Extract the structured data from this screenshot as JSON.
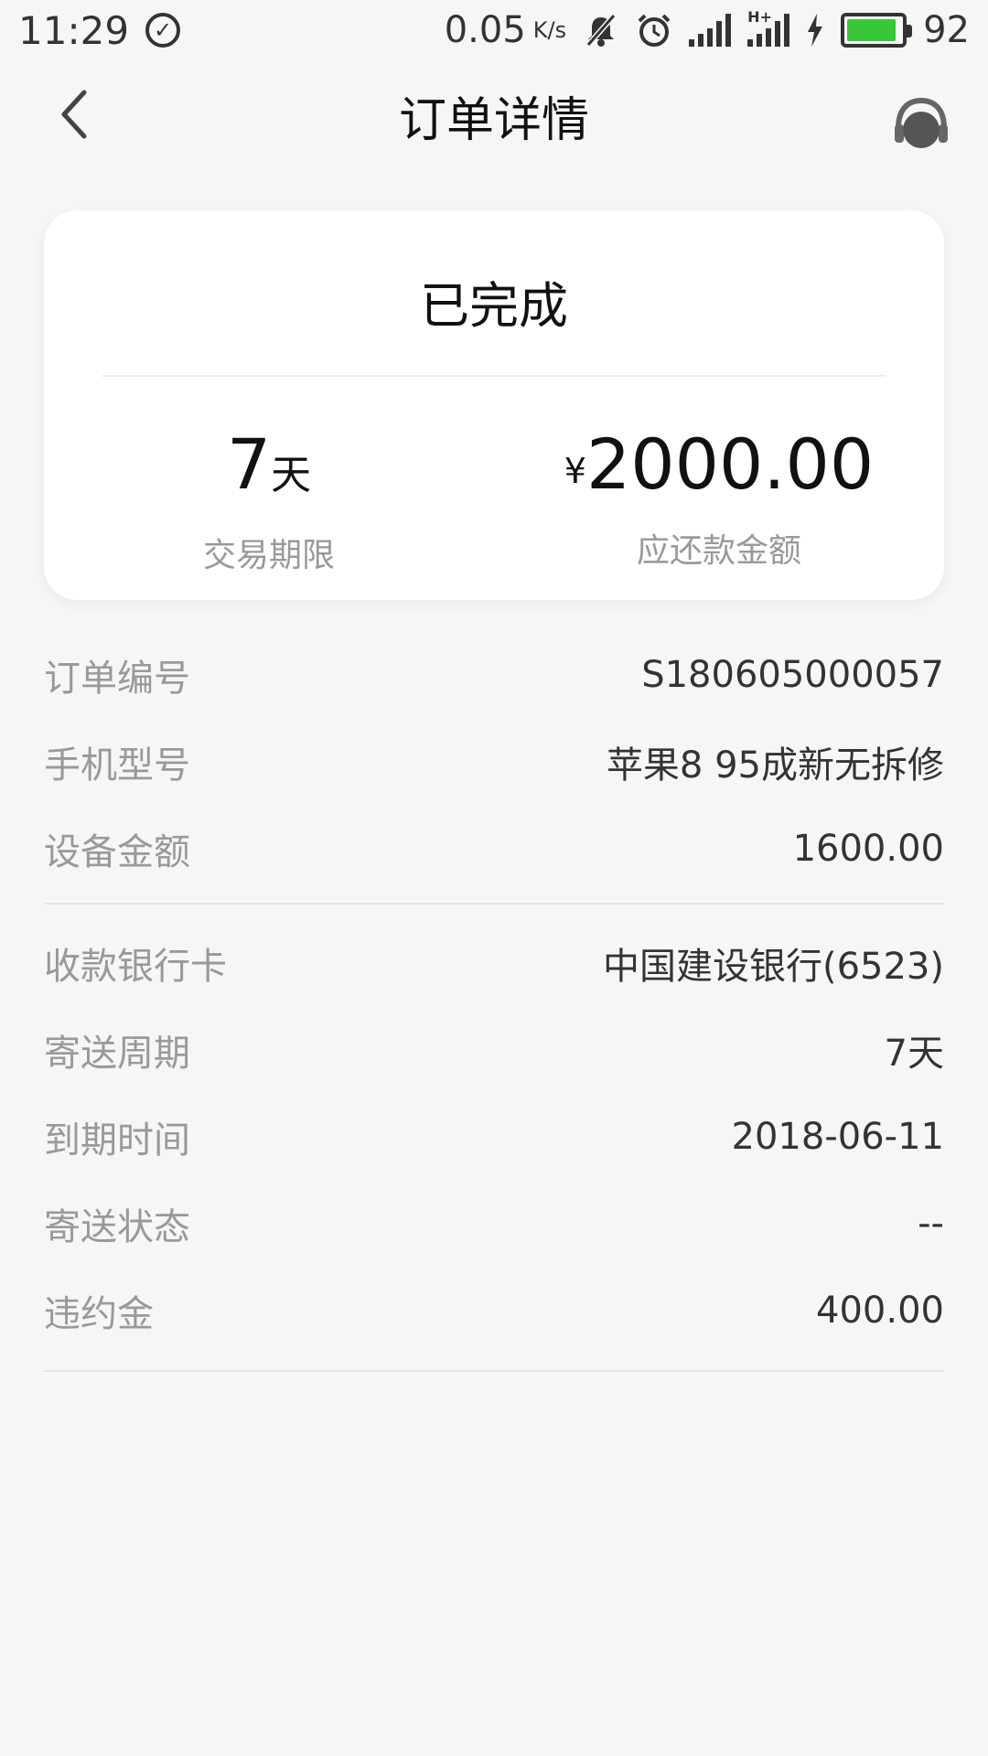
{
  "status_bar": {
    "time": "11:29",
    "speed": "0.05",
    "speed_unit": "K/s",
    "network": "H+",
    "battery": "92"
  },
  "header": {
    "title": "订单详情"
  },
  "summary": {
    "status": "已完成",
    "term_value": "7",
    "term_unit": "天",
    "term_label": "交易期限",
    "amount_currency": "¥",
    "amount_value": "2000.00",
    "amount_label": "应还款金额"
  },
  "details": {
    "group1": [
      {
        "label": "订单编号",
        "value": "S180605000057"
      },
      {
        "label": "手机型号",
        "value": "苹果8 95成新无拆修"
      },
      {
        "label": "设备金额",
        "value": "1600.00"
      }
    ],
    "group2": [
      {
        "label": "收款银行卡",
        "value": "中国建设银行(6523)"
      },
      {
        "label": "寄送周期",
        "value": "7天"
      },
      {
        "label": "到期时间",
        "value": "2018-06-11"
      },
      {
        "label": "寄送状态",
        "value": "--"
      },
      {
        "label": "违约金",
        "value": "400.00"
      }
    ]
  }
}
